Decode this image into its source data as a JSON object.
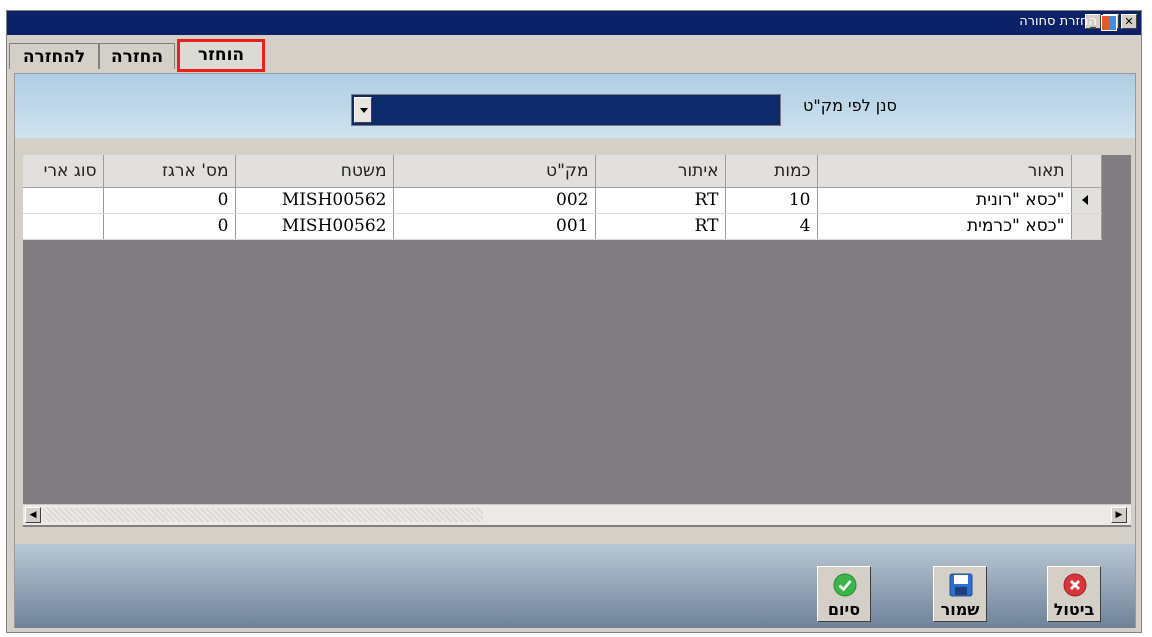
{
  "window": {
    "title": "החזרת סחורה"
  },
  "tabs": [
    {
      "label": "להחזרה"
    },
    {
      "label": "החזרה"
    },
    {
      "label": "הוחזר"
    }
  ],
  "filter": {
    "label": "סנן לפי מק\"ט",
    "selected": ""
  },
  "grid": {
    "columns": [
      "תאור",
      "כמות",
      "איתור",
      "מק\"ט",
      "משטח",
      "מס' ארגז",
      "סוג ארי"
    ],
    "rows": [
      {
        "desc": "כסא \"רונית\"",
        "qty": "10",
        "loc": "RT",
        "sku": "002",
        "pallet": "MISH00562",
        "box": "0",
        "type": ""
      },
      {
        "desc": "כסא \"כרמית\"",
        "qty": "4",
        "loc": "RT",
        "sku": "001",
        "pallet": "MISH00562",
        "box": "0",
        "type": ""
      }
    ]
  },
  "buttons": {
    "finish": "סיום",
    "save": "שמור",
    "cancel": "ביטול"
  },
  "colors": {
    "titlebar": "#0b2268",
    "grid_bg": "#817e81",
    "highlight": "#e8211e"
  }
}
